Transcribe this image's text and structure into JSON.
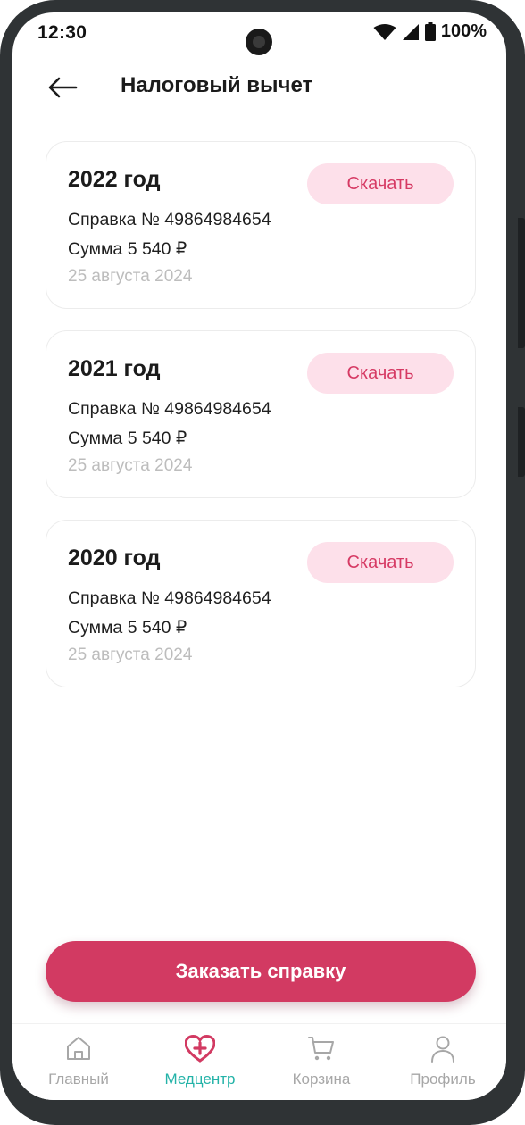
{
  "status_bar": {
    "time": "12:30",
    "battery": "100%"
  },
  "header": {
    "title": "Налоговый вычет"
  },
  "cards": [
    {
      "year": "2022 год",
      "certificate": "Справка № 49864984654",
      "amount": "Сумма 5 540 ₽",
      "date": "25 августа 2024",
      "download_label": "Скачать"
    },
    {
      "year": "2021 год",
      "certificate": "Справка № 49864984654",
      "amount": "Сумма 5 540 ₽",
      "date": "25 августа 2024",
      "download_label": "Скачать"
    },
    {
      "year": "2020 год",
      "certificate": "Справка № 49864984654",
      "amount": "Сумма 5 540 ₽",
      "date": "25 августа 2024",
      "download_label": "Скачать"
    }
  ],
  "order_button": {
    "label": "Заказать справку"
  },
  "bottom_nav": {
    "items": [
      {
        "label": "Главный",
        "icon": "home-icon",
        "active": false
      },
      {
        "label": "Медцентр",
        "icon": "medical-heart-icon",
        "active": true
      },
      {
        "label": "Корзина",
        "icon": "cart-icon",
        "active": false
      },
      {
        "label": "Профиль",
        "icon": "profile-icon",
        "active": false
      }
    ]
  },
  "colors": {
    "accent": "#d23a62",
    "download_bg": "#fde0ea",
    "download_text": "#d63a64",
    "nav_active": "#24b3a8",
    "nav_inactive": "#a7a7a7",
    "frame": "#2f3335"
  }
}
